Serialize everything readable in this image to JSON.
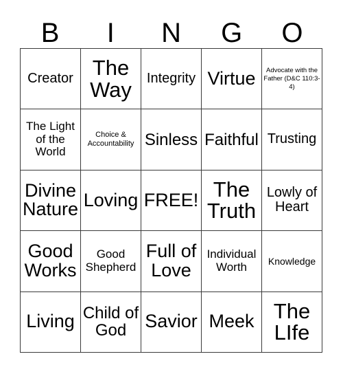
{
  "header": {
    "letters": [
      "B",
      "I",
      "N",
      "G",
      "O"
    ]
  },
  "grid": {
    "rows": 5,
    "columns": 5,
    "border_color": "#3a3a3a",
    "background_color": "#ffffff",
    "text_color": "#000000",
    "cells": [
      {
        "label": "Creator",
        "size": "md"
      },
      {
        "label": "The Way",
        "size": "xxl"
      },
      {
        "label": "Integrity",
        "size": "md"
      },
      {
        "label": "Virtue",
        "size": "xl"
      },
      {
        "label": "Advocate with the Father (D&C 110:3-4)",
        "size": "tiny"
      },
      {
        "label": "The Light of the World",
        "size": "sm"
      },
      {
        "label": "Choice & Accountability",
        "size": "xxs"
      },
      {
        "label": "Sinless",
        "size": "lg"
      },
      {
        "label": "Faithful",
        "size": "lg"
      },
      {
        "label": "Trusting",
        "size": "md"
      },
      {
        "label": "Divine Nature",
        "size": "xl"
      },
      {
        "label": "Loving",
        "size": "xl"
      },
      {
        "label": "FREE!",
        "size": "xl"
      },
      {
        "label": "The Truth",
        "size": "xxl"
      },
      {
        "label": "Lowly of Heart",
        "size": "md"
      },
      {
        "label": "Good Works",
        "size": "xl"
      },
      {
        "label": "Good Shepherd",
        "size": "sm"
      },
      {
        "label": "Full of Love",
        "size": "xl"
      },
      {
        "label": "Individual Worth",
        "size": "sm"
      },
      {
        "label": "Knowledge",
        "size": "xs"
      },
      {
        "label": "Living",
        "size": "xl"
      },
      {
        "label": "Child of God",
        "size": "lg"
      },
      {
        "label": "Savior",
        "size": "xl"
      },
      {
        "label": "Meek",
        "size": "xl"
      },
      {
        "label": "The LIfe",
        "size": "xxl"
      }
    ]
  }
}
